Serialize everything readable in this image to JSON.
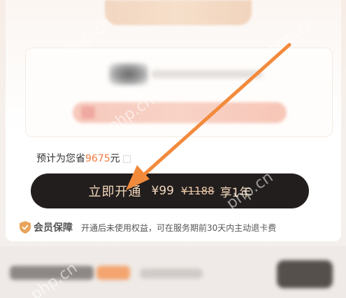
{
  "savings": {
    "prefix": "预计为您省",
    "amount": "9675",
    "unit": "元"
  },
  "purchase_button": {
    "action": "立即开通",
    "price": "¥99",
    "original_price": "¥1188",
    "term": "享1年"
  },
  "guarantee": {
    "title": "会员保障",
    "description": "开通后未使用权益，可在服务期前30天内主动退卡费"
  },
  "watermark": "php.cn",
  "colors": {
    "accent": "#f07a3c",
    "button_bg": "#221e1d",
    "button_text": "#f4d8bd",
    "arrow": "#f28a3c",
    "shield": "#e9a45b"
  },
  "icons": {
    "guarantee": "shield-icon",
    "annotation": "arrow-annotation"
  }
}
